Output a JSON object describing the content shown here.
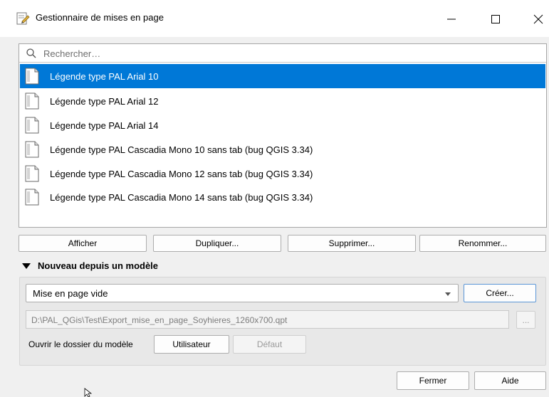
{
  "window": {
    "title": "Gestionnaire de mises en page",
    "minimize_glyph": "—",
    "maximize_glyph": "☐",
    "close_glyph": "✕"
  },
  "search": {
    "placeholder": "Rechercher…",
    "value": ""
  },
  "layouts": [
    {
      "label": "Légende type PAL Arial 10",
      "selected": true
    },
    {
      "label": "Légende type PAL Arial 12",
      "selected": false
    },
    {
      "label": "Légende type PAL Arial 14",
      "selected": false
    },
    {
      "label": "Légende type PAL Cascadia Mono 10 sans tab (bug QGIS 3.34)",
      "selected": false
    },
    {
      "label": "Légende type PAL Cascadia Mono 12 sans tab (bug QGIS 3.34)",
      "selected": false
    },
    {
      "label": "Légende type PAL Cascadia Mono 14 sans tab (bug QGIS 3.34)",
      "selected": false
    }
  ],
  "actions": {
    "show": "Afficher",
    "duplicate": "Dupliquer...",
    "delete": "Supprimer...",
    "rename": "Renommer..."
  },
  "template_section": {
    "header": "Nouveau depuis un modèle",
    "selected_template": "Mise en page vide",
    "create_button": "Créer...",
    "path_value": "D:\\PAL_QGis\\Test\\Export_mise_en_page_Soyhieres_1260x700.qpt",
    "browse_button": "...",
    "open_folder_label": "Ouvrir le dossier du modèle",
    "user_button": "Utilisateur",
    "default_button": "Défaut"
  },
  "footer": {
    "close_button": "Fermer",
    "help_button": "Aide"
  },
  "colors": {
    "selection": "#0078d7",
    "window_bg": "#f0f0f0"
  }
}
